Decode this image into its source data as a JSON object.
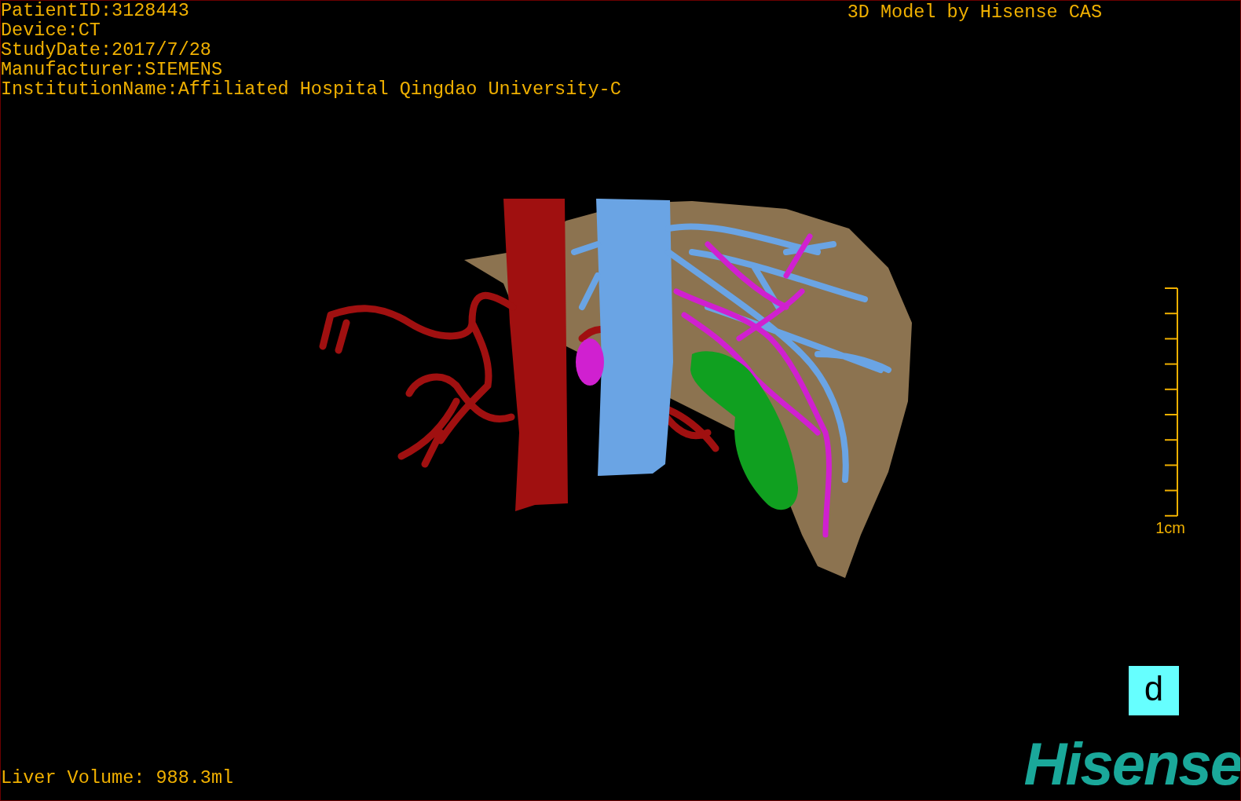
{
  "patient_info": [
    "PatientID:3128443",
    "Device:CT",
    "StudyDate:2017/7/28",
    "Manufacturer:SIEMENS",
    "InstitutionName:Affiliated Hospital Qingdao University-C"
  ],
  "title": "3D Model by Hisense CAS",
  "scale_bar": {
    "label": "1cm"
  },
  "orientation_cube": {
    "label": "d"
  },
  "logo": "Hisense",
  "liver_volume": "Liver Volume: 988.3ml"
}
